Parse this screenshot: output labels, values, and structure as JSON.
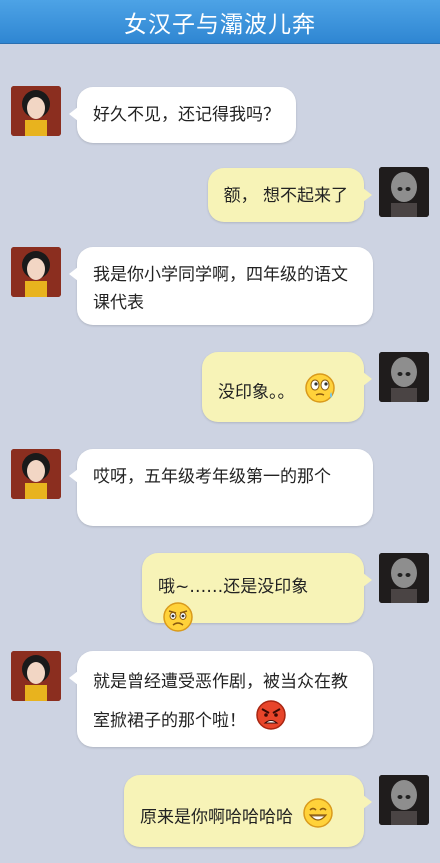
{
  "header": {
    "title": "女汉子与灞波儿奔"
  },
  "messages": [
    {
      "side": "left",
      "text": "好久不见，还记得我吗？"
    },
    {
      "side": "right",
      "text": "额， 想不起来了"
    },
    {
      "side": "left",
      "text": "我是你小学同学啊，四年级的语文课代表"
    },
    {
      "side": "right",
      "text": "没印象。。",
      "emoji": "sweat-eyes-emoji"
    },
    {
      "side": "left",
      "text": "哎呀，五年级考年级第一的那个"
    },
    {
      "side": "right",
      "text": "哦~……还是没印象",
      "emoji": "confused-emoji"
    },
    {
      "side": "left",
      "text": "就是曾经遭受恶作剧，被当众在教室掀裙子的那个啦！",
      "emoji": "angry-emoji"
    },
    {
      "side": "right",
      "text": "原来是你啊哈哈哈哈",
      "emoji": "laughing-emoji"
    }
  ],
  "colors": {
    "header": "#3a90d8",
    "background": "#cdd3e2",
    "left_bubble": "#ffffff",
    "right_bubble": "#f7f3b7"
  }
}
